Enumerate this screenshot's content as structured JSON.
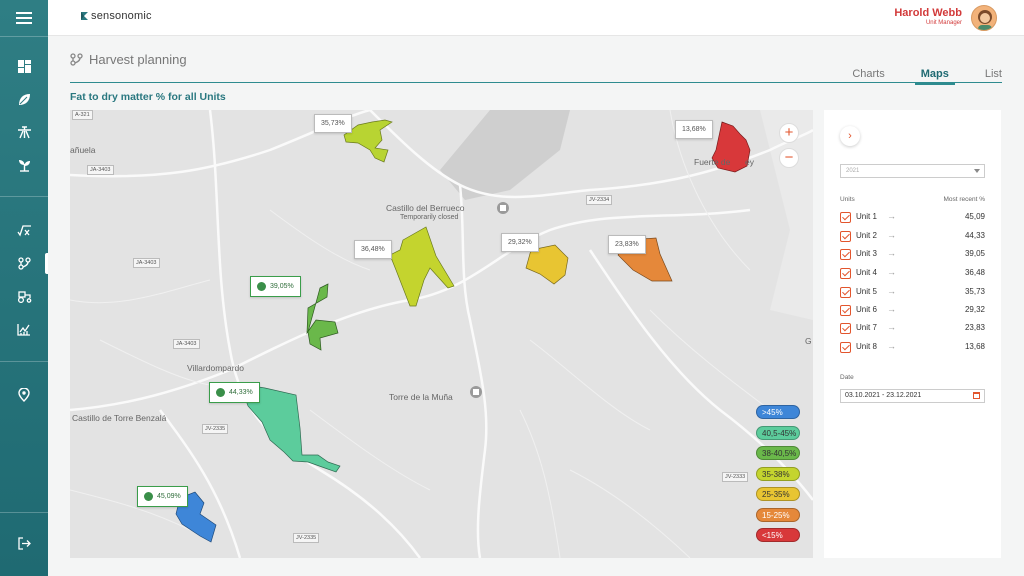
{
  "app": {
    "brand": "sensonomic"
  },
  "user": {
    "name": "Harold Webb",
    "role": "Unit Manager"
  },
  "page": {
    "title": "Harvest planning",
    "subheading": "Fat to dry matter % for all Units"
  },
  "tabs": [
    {
      "label": "Charts",
      "active": false
    },
    {
      "label": "Maps",
      "active": true
    },
    {
      "label": "List",
      "active": false
    }
  ],
  "sidebar": {
    "items": [
      {
        "icon": "dashboard-icon"
      },
      {
        "icon": "leaf-icon"
      },
      {
        "icon": "field-icon"
      },
      {
        "icon": "sprout-icon"
      },
      {
        "icon": "formula-icon"
      },
      {
        "icon": "harvest-planning-icon",
        "active": true
      },
      {
        "icon": "tractor-icon"
      },
      {
        "icon": "analytics-icon"
      },
      {
        "icon": "location-icon"
      },
      {
        "icon": "logout-icon"
      }
    ]
  },
  "map": {
    "places": [
      "añuela",
      "Castillo del Berrueco",
      "Temporarily closed",
      "Fuerte de",
      "ey",
      "Villardompardo",
      "Castillo de Torre Benzalá",
      "Torre de la Muña",
      "G"
    ],
    "roads": [
      "A-321",
      "JA-3403",
      "JA-3403",
      "JA-3403",
      "JV-2334",
      "JV-2335",
      "JV-2333",
      "JV-2335"
    ],
    "labels": [
      {
        "text": "35,73%",
        "unit": "Unit 5",
        "color": "#b8d432"
      },
      {
        "text": "13,68%",
        "unit": "Unit 8",
        "color": "#d8383a"
      },
      {
        "text": "36,48%",
        "unit": "Unit 4",
        "color": "#c4d42e"
      },
      {
        "text": "29,32%",
        "unit": "Unit 6",
        "color": "#e8c532"
      },
      {
        "text": "23,83%",
        "unit": "Unit 7",
        "color": "#e5883a"
      },
      {
        "text": "39,05%",
        "unit": "Unit 3",
        "color": "#6ab84a"
      },
      {
        "text": "44,33%",
        "unit": "Unit 2",
        "color": "#5ccc9c"
      },
      {
        "text": "45,09%",
        "unit": "Unit 1",
        "color": "#3e86d8"
      }
    ],
    "legend": [
      {
        "label": ">45%",
        "color": "#3e86d8"
      },
      {
        "label": "40,5-45%",
        "color": "#5ccc9c"
      },
      {
        "label": "38-40,5%",
        "color": "#6ab84a"
      },
      {
        "label": "35-38%",
        "color": "#c4d42e"
      },
      {
        "label": "25-35%",
        "color": "#e8c532"
      },
      {
        "label": "15-25%",
        "color": "#e5883a"
      },
      {
        "label": "<15%",
        "color": "#d8383a"
      }
    ]
  },
  "panel": {
    "year": "2021",
    "units_header": "Units",
    "recent_header": "Most recent %",
    "units": [
      {
        "label": "Unit 1",
        "value": "45,09"
      },
      {
        "label": "Unit 2",
        "value": "44,33"
      },
      {
        "label": "Unit 3",
        "value": "39,05"
      },
      {
        "label": "Unit 4",
        "value": "36,48"
      },
      {
        "label": "Unit 5",
        "value": "35,73"
      },
      {
        "label": "Unit 6",
        "value": "29,32"
      },
      {
        "label": "Unit 7",
        "value": "23,83"
      },
      {
        "label": "Unit 8",
        "value": "13,68"
      }
    ],
    "date_label": "Date",
    "date_range": "03.10.2021 - 23.12.2021"
  }
}
